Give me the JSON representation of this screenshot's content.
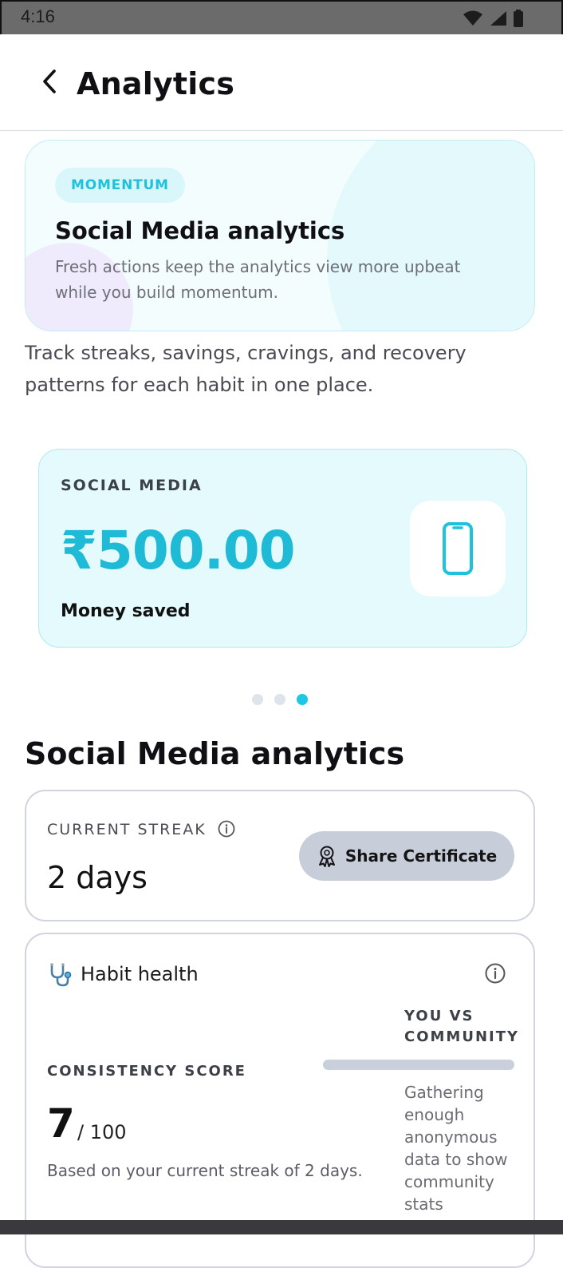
{
  "status_bar": {
    "time": "4:16",
    "icons": [
      "wifi-icon",
      "cell-signal-icon",
      "battery-icon"
    ]
  },
  "app_bar": {
    "title": "Analytics",
    "back_icon": "chevron-left-icon"
  },
  "hero": {
    "pill": "MOMENTUM",
    "title": "Social Media analytics",
    "body": "Fresh actions keep the analytics view more upbeat while you build momentum."
  },
  "intro": "Track streaks, savings, cravings, and recovery patterns for each habit in one place.",
  "money_card": {
    "label": "SOCIAL MEDIA",
    "amount": "₹500.00",
    "caption": "Money saved",
    "icon": "smartphone-icon"
  },
  "carousel": {
    "count": 3,
    "active_index": 2
  },
  "section_title": "Social Media analytics",
  "streak": {
    "label": "CURRENT STREAK",
    "value": "2 days",
    "share_label": "Share Certificate",
    "share_icon": "award-ribbon-icon"
  },
  "health": {
    "title": "Habit health",
    "icon": "stethoscope-icon",
    "consistency_label": "CONSISTENCY SCORE",
    "score": "7",
    "score_max": "/ 100",
    "basis": "Based on your current streak of 2 days.",
    "compare_title": "YOU VS COMMUNITY",
    "compare_note": "Gathering enough anonymous data to show community stats"
  },
  "colors": {
    "accent": "#1EC2DC",
    "money_card_bg": "#E4FAFC",
    "share_button_bg": "#C7CEDA",
    "card_border": "#CFD4DE"
  }
}
